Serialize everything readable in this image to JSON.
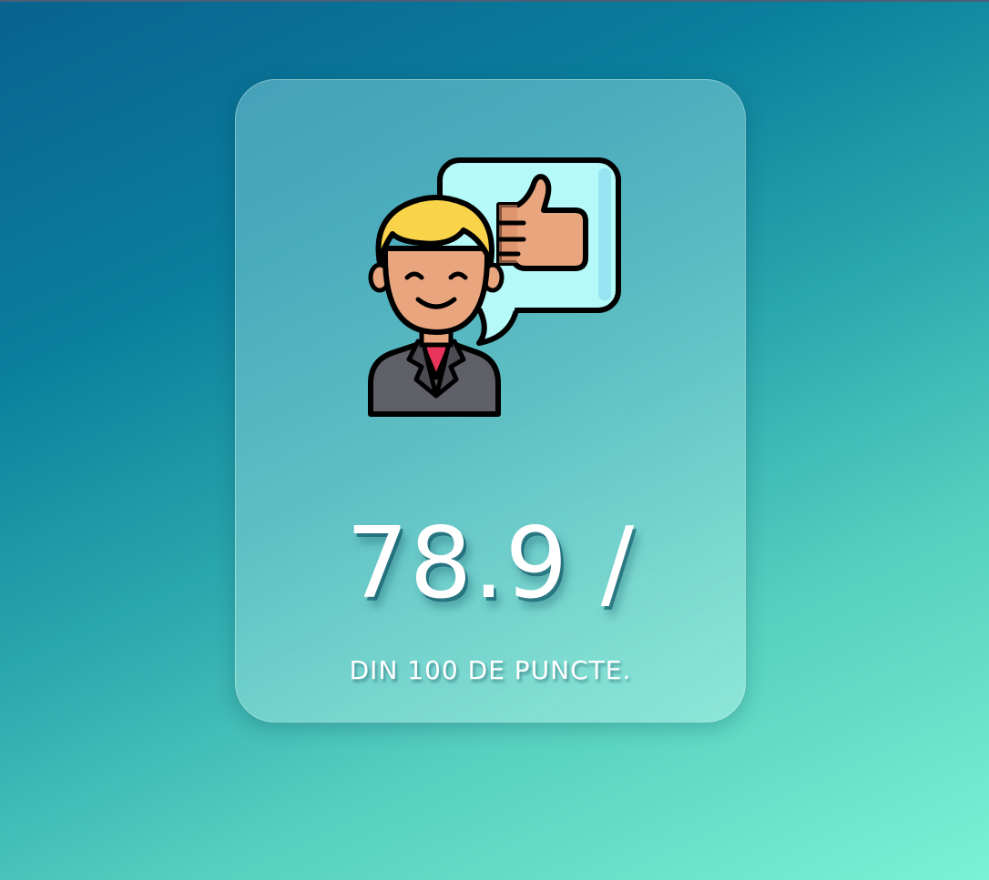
{
  "score": {
    "value_text": "78.9 /",
    "caption": "DIN 100 DE PUNCTE."
  },
  "illustration": {
    "icon": "person-thumbs-up-speech-bubble-icon"
  },
  "colors": {
    "background_start": "#09628f",
    "background_end": "#7af2d4",
    "bubble": "#b5f9f9",
    "hair": "#f9d34a",
    "skin": "#e9a57e",
    "suit": "#5f5f68",
    "shirt": "#e8345a"
  }
}
